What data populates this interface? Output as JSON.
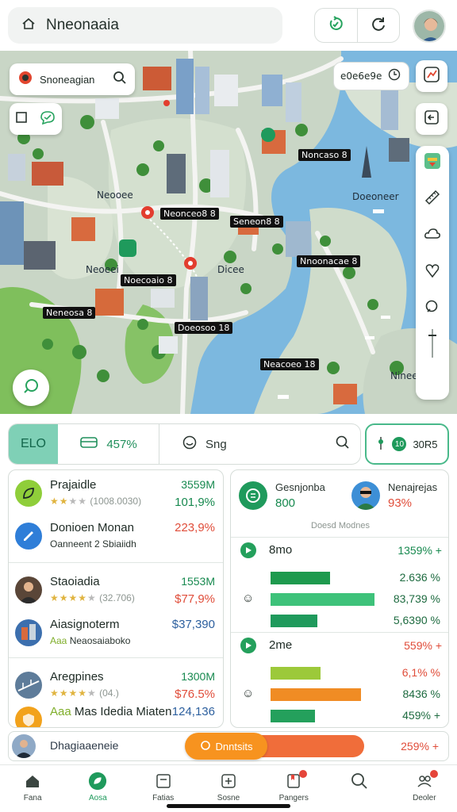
{
  "topbar": {
    "search_text": "Nneonaaia",
    "icons": [
      "home-outline-icon",
      "refresh-check-icon",
      "refresh-icon",
      "avatar"
    ]
  },
  "map": {
    "search_text": "Snoneagian",
    "time_text": "e0e6e9e",
    "labels": [
      {
        "text": "Neonceo8 8",
        "style": "dark"
      },
      {
        "text": "Seneon8 8",
        "style": "dark"
      },
      {
        "text": "Noncaso 8",
        "style": "dark"
      },
      {
        "text": "Nnoonacae 8",
        "style": "dark"
      },
      {
        "text": "Noecoaio 8",
        "style": "dark"
      },
      {
        "text": "Neneosa 8",
        "style": "dark"
      },
      {
        "text": "Doeosoo 18",
        "style": "dark"
      },
      {
        "text": "Neacoeo 18",
        "style": "dark"
      },
      {
        "text": "Neooee",
        "style": "plain"
      },
      {
        "text": "Doeoneer",
        "style": "plain"
      },
      {
        "text": "Dicee",
        "style": "plain"
      },
      {
        "text": "Neoeei",
        "style": "plain"
      },
      {
        "text": "Nineeo",
        "style": "plain"
      }
    ]
  },
  "filters": {
    "tab_a": "ELO",
    "tab_b": "457%",
    "search_text": "Sng",
    "total_text": "30R5",
    "total_dot": "10"
  },
  "list": [
    {
      "title": "Prajaidle",
      "stars": 2,
      "sub": "(1008.0030)",
      "v1": "3559M",
      "v2": "101,9%",
      "v2_color": "#17894f"
    },
    {
      "title": "Donioen Monan",
      "sub": "Oanneent 2 Sbiaiidh",
      "v1": "",
      "v2": "223,9%",
      "v2_color": "#e04d3a"
    },
    {
      "title": "Staoiadia",
      "stars": 4,
      "sub": "(32.706)",
      "v1": "1553M",
      "v2": "$77,9%",
      "v2_color": "#e04d3a"
    },
    {
      "title": "Aiasignoterm",
      "sub": "Aaa Neaosaiaboko",
      "v1": "",
      "v2": "$37,390",
      "v2_color": "#2c5f9e"
    },
    {
      "title": "Aregpines",
      "stars": 4,
      "sub": "(04.)",
      "v1": "1300M",
      "v2": "$76.5%",
      "v2_color": "#e04d3a"
    },
    {
      "title": "Aaa Mas Idedia Miaten",
      "sub": "",
      "v1": "",
      "v2": "124,136",
      "v2_color": "#2c5f9e"
    }
  ],
  "stats": {
    "kpi1_name": "Gesnjonba",
    "kpi1_value": "800",
    "kpi2_name": "Nenajrejas",
    "kpi2_value": "93%",
    "caption": "Doesd Modnes",
    "group1": {
      "name": "8mo",
      "value": "1359% +"
    },
    "group1_bars": [
      {
        "value": "2.636 %",
        "fill": 0.44,
        "color": "#1e9a4e",
        "value_color": "#1e6b40"
      },
      {
        "value": "83,739 %",
        "fill": 0.77,
        "color": "#3ec27a",
        "value_color": "#1e6b40"
      },
      {
        "value": "5,6390 %",
        "fill": 0.35,
        "color": "#1f9a5c",
        "value_color": "#1e6b40"
      }
    ],
    "group2": {
      "name": "2me",
      "value": "559% +"
    },
    "group2_bars": [
      {
        "value": "6,1% %",
        "fill": 0.37,
        "color": "#9cc93a",
        "value_color": "#e04d3a"
      },
      {
        "value": "8436 %",
        "fill": 0.67,
        "color": "#f08c24",
        "value_color": "#1e6b40"
      },
      {
        "value": "459% +",
        "fill": 0.33,
        "color": "#24a05c",
        "value_color": "#1e6b40"
      }
    ]
  },
  "summary": {
    "name": "Dhagiaaeneie",
    "button": "Dnntsits",
    "value": "259% +"
  },
  "nav": [
    {
      "label": "Fana",
      "icon": "home-icon"
    },
    {
      "label": "Aosa",
      "icon": "leaf-icon",
      "active": true
    },
    {
      "label": "Fatias",
      "icon": "list-icon"
    },
    {
      "label": "Sosne",
      "icon": "plus-icon"
    },
    {
      "label": "Pangers",
      "icon": "bookmark-icon",
      "badge": true
    },
    {
      "label": "",
      "icon": "search-icon"
    },
    {
      "label": "Deoler",
      "icon": "user-icon",
      "badge": true
    }
  ]
}
